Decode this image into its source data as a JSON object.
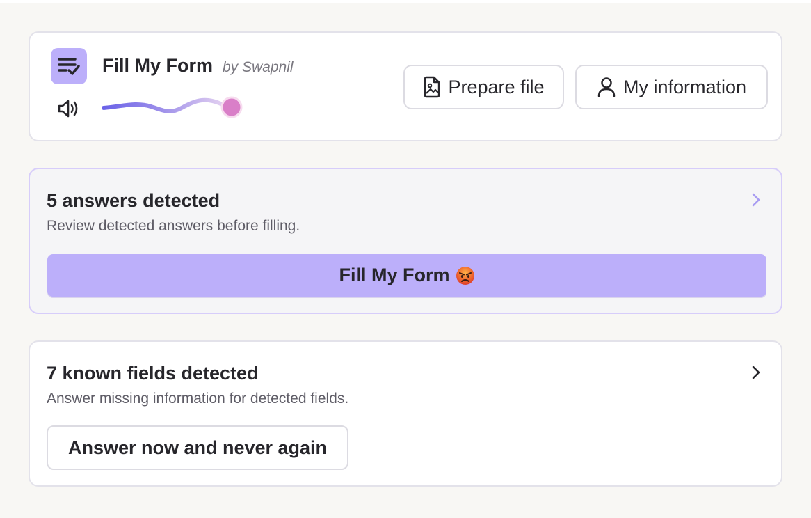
{
  "header": {
    "app_title": "Fill My Form",
    "byline": "by Swapnil",
    "logo_icon": "checklist-icon",
    "volume_icon": "speaker-icon",
    "volume_level": 1.0,
    "prepare_file_label": "Prepare file",
    "prepare_file_icon": "file-image-icon",
    "my_information_label": "My information",
    "my_information_icon": "user-icon"
  },
  "answers": {
    "title": "5 answers detected",
    "subtitle": "Review detected answers before filling.",
    "fill_button_label": "Fill My Form",
    "fill_button_emoji": "angry-face-emoji",
    "chevron_icon": "chevron-right-icon"
  },
  "fields": {
    "title": "7 known fields detected",
    "subtitle": "Answer missing information for detected fields.",
    "answer_button_label": "Answer now and never again",
    "chevron_icon": "chevron-right-icon"
  },
  "colors": {
    "accent": "#bcaffa",
    "accent_border": "#d7cdfa",
    "slider_start": "#6b63e8",
    "slider_thumb": "#d97fc8",
    "background": "#f8f7f4"
  }
}
